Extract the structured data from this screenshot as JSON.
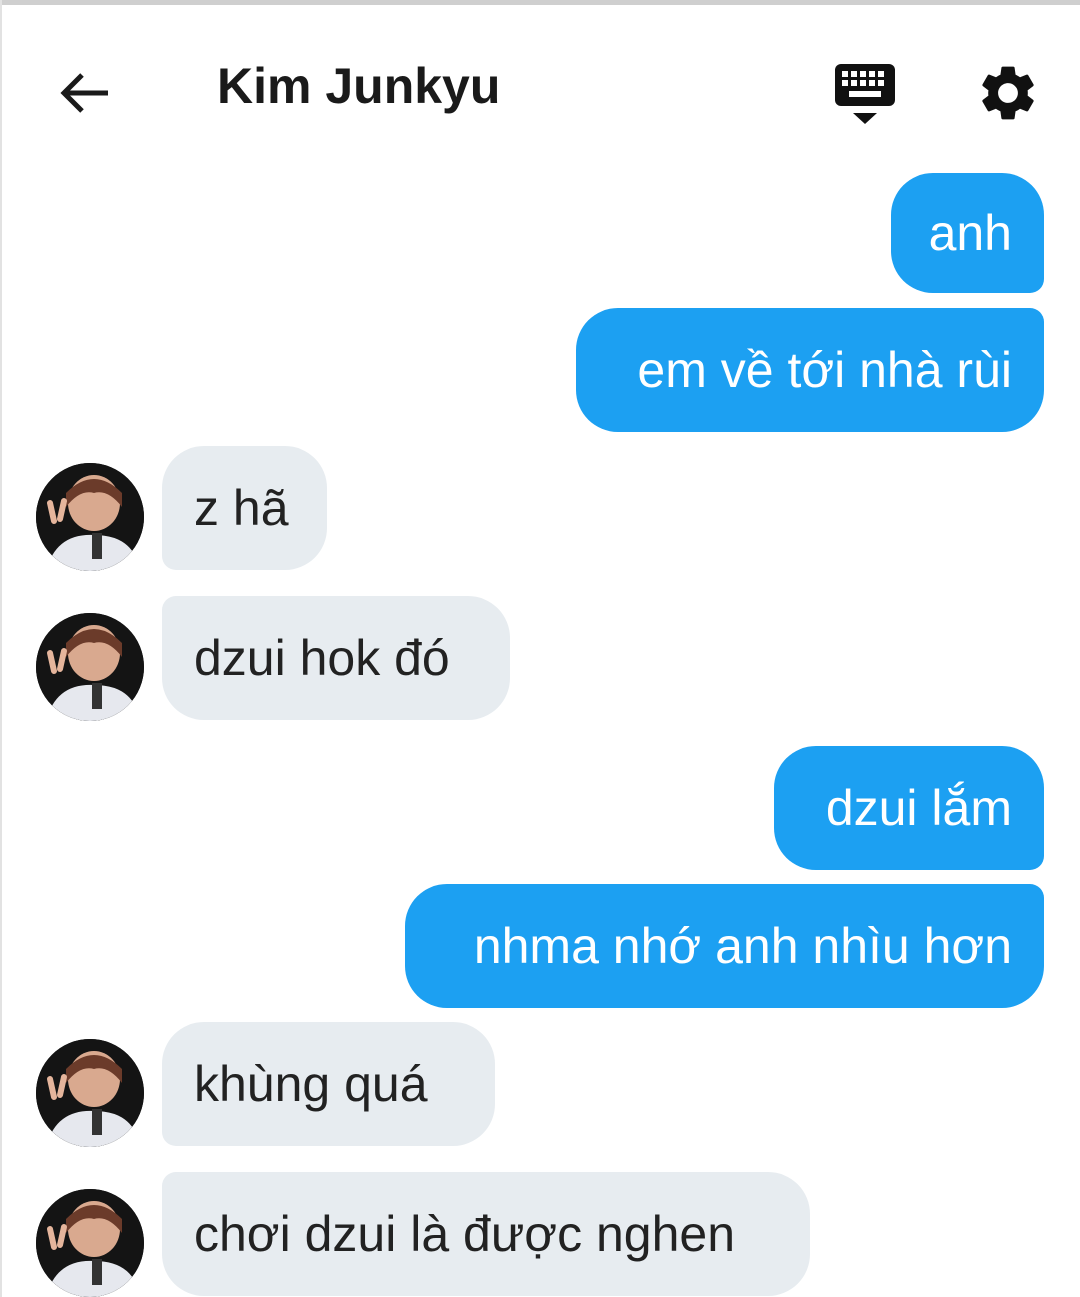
{
  "header": {
    "title": "Kim Junkyu"
  },
  "icons": {
    "back": "arrow-back-icon",
    "keyboard": "keyboard-icon",
    "settings": "gear-icon"
  },
  "colors": {
    "sent_bubble": "#1ca0f2",
    "received_bubble": "#e7ecf0",
    "sent_text": "#ffffff",
    "received_text": "#222222"
  },
  "messages": [
    {
      "from": "me",
      "text": "anh"
    },
    {
      "from": "me",
      "text": "em về tới nhà rùi"
    },
    {
      "from": "them",
      "text": "z hã"
    },
    {
      "from": "them",
      "text": "dzui hok đó"
    },
    {
      "from": "me",
      "text": "dzui lắm"
    },
    {
      "from": "me",
      "text": "nhma nhớ anh nhìu hơn"
    },
    {
      "from": "them",
      "text": "khùng quá"
    },
    {
      "from": "them",
      "text": "chơi dzui là được nghen"
    }
  ]
}
